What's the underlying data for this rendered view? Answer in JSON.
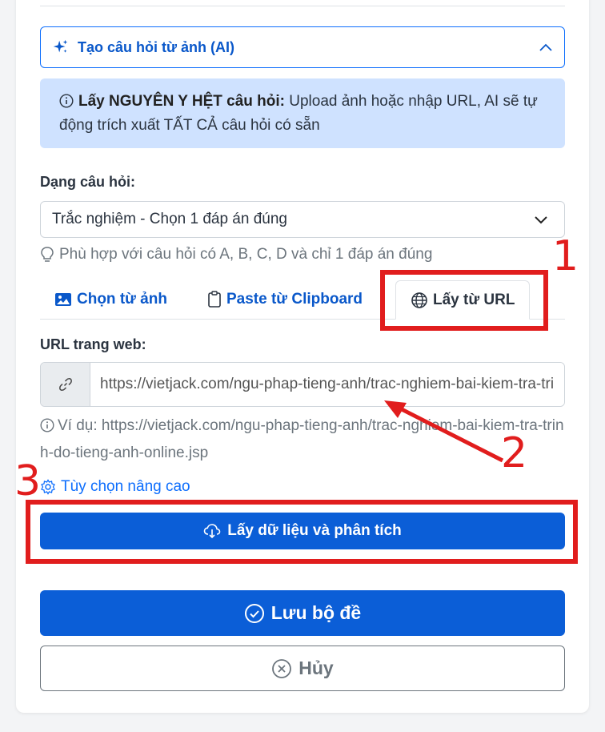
{
  "ai_section": {
    "title": "Tạo câu hỏi từ ảnh (AI)"
  },
  "info": {
    "bold": "Lấy NGUYÊN Y HỆT câu hỏi:",
    "text": " Upload ảnh hoặc nhập URL, AI sẽ tự động trích xuất TẤT CẢ câu hỏi có sẵn"
  },
  "question_type": {
    "label": "Dạng câu hỏi:",
    "selected": "Trắc nghiệm - Chọn 1 đáp án đúng",
    "hint": "Phù hợp với câu hỏi có A, B, C, D và chỉ 1 đáp án đúng"
  },
  "tabs": [
    {
      "label": "Chọn từ ảnh",
      "icon": "image-icon"
    },
    {
      "label": "Paste từ Clipboard",
      "icon": "clipboard-icon"
    },
    {
      "label": "Lấy từ URL",
      "icon": "globe-icon",
      "active": true
    }
  ],
  "url": {
    "label": "URL trang web:",
    "value": "https://vietjack.com/ngu-phap-tieng-anh/trac-nghiem-bai-kiem-tra-trinh-do-tieng-anh-online.jsp",
    "example_prefix": "Ví dụ: ",
    "example": "https://vietjack.com/ngu-phap-tieng-anh/trac-nghiem-bai-kiem-tra-trinh-do-tieng-anh-online.jsp"
  },
  "advanced_link": "Tùy chọn nâng cao",
  "buttons": {
    "fetch": "Lấy dữ liệu và phân tích",
    "save": "Lưu bộ đề",
    "cancel": "Hủy"
  },
  "annotations": {
    "n1": "1",
    "n2": "2",
    "n3": "3",
    "color": "#e11d1d"
  },
  "colors": {
    "primary": "#0b5ed7",
    "info_bg": "#cfe2ff"
  }
}
